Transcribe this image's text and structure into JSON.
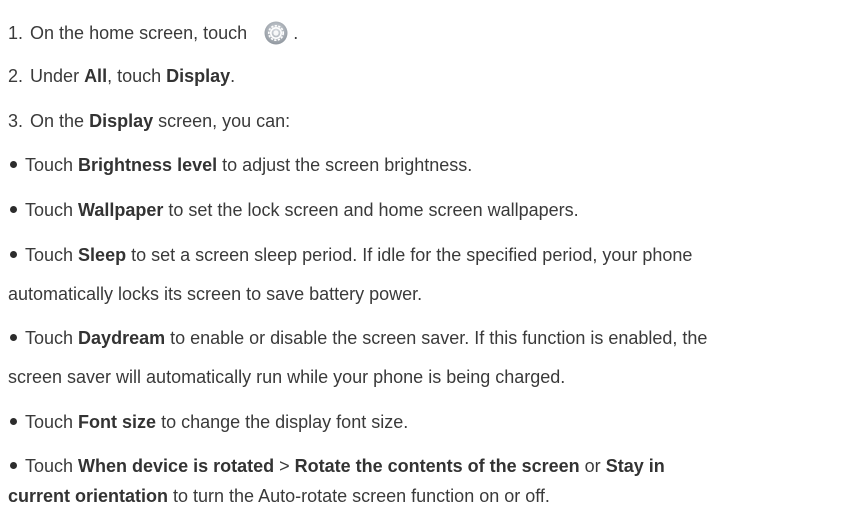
{
  "steps": [
    {
      "num": "1.",
      "text_before": "On the home screen, touch",
      "icon": "settings-gear-icon",
      "text_after": "."
    },
    {
      "num": "2.",
      "prefix": "Under ",
      "b1": "All",
      "mid": ", touch ",
      "b2": "Display",
      "suffix": "."
    },
    {
      "num": "3.",
      "prefix": "On the ",
      "b1": "Display",
      "suffix": " screen, you can:"
    }
  ],
  "bullets": [
    {
      "prefix": "Touch ",
      "bold": "Brightness level",
      "suffix": " to adjust the screen brightness."
    },
    {
      "prefix": "Touch ",
      "bold": "Wallpaper",
      "suffix": " to set the lock screen and home screen wallpapers."
    },
    {
      "prefix": "Touch ",
      "bold": "Sleep",
      "suffix": " to set a screen sleep period. If idle for the specified period, your phone",
      "continuation": "automatically locks its screen to save battery power."
    },
    {
      "prefix": "Touch ",
      "bold": "Daydream",
      "suffix": " to enable or disable the screen saver. If this function is enabled, the",
      "continuation": "screen saver will automatically run while your phone is being charged."
    },
    {
      "prefix": "Touch ",
      "bold": "Font size",
      "suffix": " to change the display font size."
    },
    {
      "prefix": "Touch ",
      "bold": "When device is rotated",
      "sep": " > ",
      "bold2": "Rotate the contents of the screen",
      "or": " or ",
      "bold3": "Stay in",
      "continuation_bold": "current orientation",
      "continuation": " to turn the Auto-rotate screen function on or off."
    }
  ]
}
